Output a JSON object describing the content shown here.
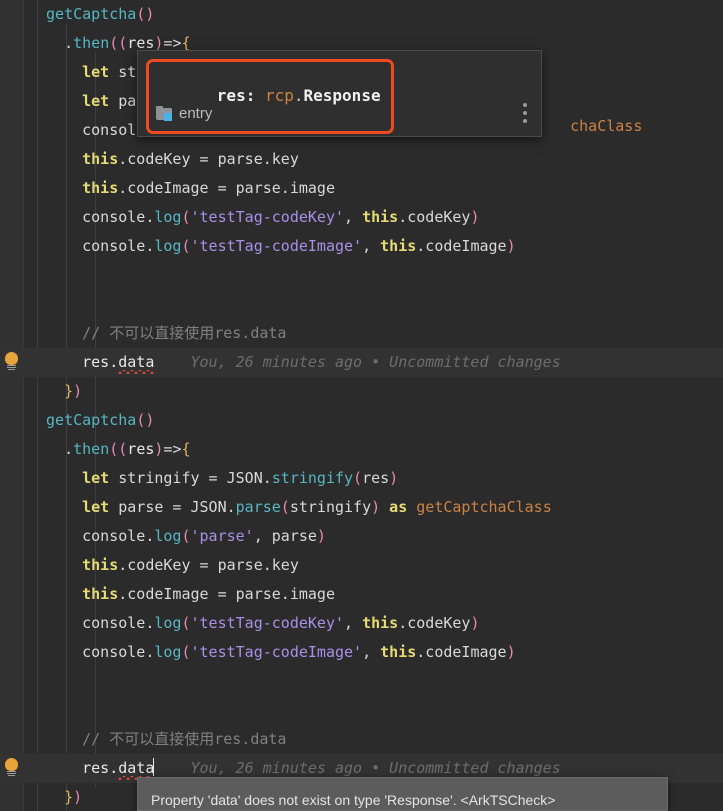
{
  "editor": {
    "theme_bg": "#2b2b2b",
    "gutter_bg": "#313131",
    "current_line_bg": "#323232"
  },
  "gutter": {
    "bulb_icon_name": "intention-bulb-icon",
    "bulb_color": "#e8a33d"
  },
  "code_lines": [
    {
      "indent": 1,
      "tokens": [
        {
          "t": "getCaptcha",
          "c": "t-fn"
        },
        {
          "t": "(",
          "c": "t-paren"
        },
        {
          "t": ")",
          "c": "t-paren"
        }
      ]
    },
    {
      "indent": 2,
      "tokens": [
        {
          "t": ".",
          "c": "t-plain"
        },
        {
          "t": "then",
          "c": "t-method"
        },
        {
          "t": "((",
          "c": "t-paren"
        },
        {
          "t": "res",
          "c": "t-white"
        },
        {
          "t": ")",
          "c": "t-paren"
        },
        {
          "t": "=>",
          "c": "t-plain"
        },
        {
          "t": "{",
          "c": "t-punct"
        }
      ]
    },
    {
      "indent": 3,
      "tokens": [
        {
          "t": "let",
          "c": "t-kw"
        },
        {
          "t": " st",
          "c": "t-plain"
        }
      ]
    },
    {
      "indent": 3,
      "tokens": [
        {
          "t": "let",
          "c": "t-kw"
        },
        {
          "t": " pa",
          "c": "t-plain"
        }
      ]
    },
    {
      "indent": 3,
      "tokens": [
        {
          "t": "consol",
          "c": "t-plain"
        }
      ]
    },
    {
      "indent": 3,
      "tokens": [
        {
          "t": "this",
          "c": "t-kw"
        },
        {
          "t": ".codeKey ",
          "c": "t-plain"
        },
        {
          "t": "=",
          "c": "t-op"
        },
        {
          "t": " parse.key",
          "c": "t-plain"
        }
      ]
    },
    {
      "indent": 3,
      "tokens": [
        {
          "t": "this",
          "c": "t-kw"
        },
        {
          "t": ".codeImage ",
          "c": "t-plain"
        },
        {
          "t": "=",
          "c": "t-op"
        },
        {
          "t": " parse.image",
          "c": "t-plain"
        }
      ]
    },
    {
      "indent": 3,
      "tokens": [
        {
          "t": "console",
          "c": "t-plain"
        },
        {
          "t": ".",
          "c": "t-plain"
        },
        {
          "t": "log",
          "c": "t-method"
        },
        {
          "t": "(",
          "c": "t-paren"
        },
        {
          "t": "'testTag-codeKey'",
          "c": "t-str"
        },
        {
          "t": ", ",
          "c": "t-plain"
        },
        {
          "t": "this",
          "c": "t-kw"
        },
        {
          "t": ".codeKey",
          "c": "t-plain"
        },
        {
          "t": ")",
          "c": "t-paren"
        }
      ]
    },
    {
      "indent": 3,
      "tokens": [
        {
          "t": "console",
          "c": "t-plain"
        },
        {
          "t": ".",
          "c": "t-plain"
        },
        {
          "t": "log",
          "c": "t-method"
        },
        {
          "t": "(",
          "c": "t-paren"
        },
        {
          "t": "'testTag-codeImage'",
          "c": "t-str"
        },
        {
          "t": ", ",
          "c": "t-plain"
        },
        {
          "t": "this",
          "c": "t-kw"
        },
        {
          "t": ".codeImage",
          "c": "t-plain"
        },
        {
          "t": ")",
          "c": "t-paren"
        }
      ]
    },
    {
      "indent": 0,
      "tokens": []
    },
    {
      "indent": 0,
      "tokens": []
    },
    {
      "indent": 3,
      "tokens": [
        {
          "t": "// 不可以直接使用res.data",
          "c": "t-comment"
        }
      ]
    },
    {
      "indent": 3,
      "tokens": [
        {
          "t": "res.",
          "c": "t-white"
        },
        {
          "t": "data",
          "c": "t-white",
          "squiggle": true
        }
      ],
      "blame": "You, 26 minutes ago • Uncommitted changes",
      "current": true
    },
    {
      "indent": 2,
      "tokens": [
        {
          "t": "}",
          "c": "t-punct"
        },
        {
          "t": ")",
          "c": "t-paren"
        }
      ]
    },
    {
      "indent": 1,
      "tokens": [
        {
          "t": "getCaptcha",
          "c": "t-fn"
        },
        {
          "t": "(",
          "c": "t-paren"
        },
        {
          "t": ")",
          "c": "t-paren"
        }
      ]
    },
    {
      "indent": 2,
      "tokens": [
        {
          "t": ".",
          "c": "t-plain"
        },
        {
          "t": "then",
          "c": "t-method"
        },
        {
          "t": "((",
          "c": "t-paren"
        },
        {
          "t": "res",
          "c": "t-white"
        },
        {
          "t": ")",
          "c": "t-paren"
        },
        {
          "t": "=>",
          "c": "t-plain"
        },
        {
          "t": "{",
          "c": "t-punct"
        }
      ]
    },
    {
      "indent": 3,
      "tokens": [
        {
          "t": "let",
          "c": "t-kw"
        },
        {
          "t": " stringify ",
          "c": "t-plain"
        },
        {
          "t": "=",
          "c": "t-op"
        },
        {
          "t": " JSON",
          "c": "t-plain"
        },
        {
          "t": ".",
          "c": "t-plain"
        },
        {
          "t": "stringify",
          "c": "t-method"
        },
        {
          "t": "(",
          "c": "t-paren"
        },
        {
          "t": "res",
          "c": "t-plain"
        },
        {
          "t": ")",
          "c": "t-paren"
        }
      ]
    },
    {
      "indent": 3,
      "tokens": [
        {
          "t": "let",
          "c": "t-kw"
        },
        {
          "t": " parse ",
          "c": "t-plain"
        },
        {
          "t": "=",
          "c": "t-op"
        },
        {
          "t": " JSON",
          "c": "t-plain"
        },
        {
          "t": ".",
          "c": "t-plain"
        },
        {
          "t": "parse",
          "c": "t-method"
        },
        {
          "t": "(",
          "c": "t-paren"
        },
        {
          "t": "stringify",
          "c": "t-plain"
        },
        {
          "t": ")",
          "c": "t-paren"
        },
        {
          "t": " ",
          "c": "t-plain"
        },
        {
          "t": "as",
          "c": "t-kw"
        },
        {
          "t": " ",
          "c": "t-plain"
        },
        {
          "t": "getCaptchaClass",
          "c": "t-cls"
        }
      ]
    },
    {
      "indent": 3,
      "tokens": [
        {
          "t": "console",
          "c": "t-plain"
        },
        {
          "t": ".",
          "c": "t-plain"
        },
        {
          "t": "log",
          "c": "t-method"
        },
        {
          "t": "(",
          "c": "t-paren"
        },
        {
          "t": "'parse'",
          "c": "t-str"
        },
        {
          "t": ", parse",
          "c": "t-plain"
        },
        {
          "t": ")",
          "c": "t-paren"
        }
      ]
    },
    {
      "indent": 3,
      "tokens": [
        {
          "t": "this",
          "c": "t-kw"
        },
        {
          "t": ".codeKey ",
          "c": "t-plain"
        },
        {
          "t": "=",
          "c": "t-op"
        },
        {
          "t": " parse.key",
          "c": "t-plain"
        }
      ]
    },
    {
      "indent": 3,
      "tokens": [
        {
          "t": "this",
          "c": "t-kw"
        },
        {
          "t": ".codeImage ",
          "c": "t-plain"
        },
        {
          "t": "=",
          "c": "t-op"
        },
        {
          "t": " parse.image",
          "c": "t-plain"
        }
      ]
    },
    {
      "indent": 3,
      "tokens": [
        {
          "t": "console",
          "c": "t-plain"
        },
        {
          "t": ".",
          "c": "t-plain"
        },
        {
          "t": "log",
          "c": "t-method"
        },
        {
          "t": "(",
          "c": "t-paren"
        },
        {
          "t": "'testTag-codeKey'",
          "c": "t-str"
        },
        {
          "t": ", ",
          "c": "t-plain"
        },
        {
          "t": "this",
          "c": "t-kw"
        },
        {
          "t": ".codeKey",
          "c": "t-plain"
        },
        {
          "t": ")",
          "c": "t-paren"
        }
      ]
    },
    {
      "indent": 3,
      "tokens": [
        {
          "t": "console",
          "c": "t-plain"
        },
        {
          "t": ".",
          "c": "t-plain"
        },
        {
          "t": "log",
          "c": "t-method"
        },
        {
          "t": "(",
          "c": "t-paren"
        },
        {
          "t": "'testTag-codeImage'",
          "c": "t-str"
        },
        {
          "t": ", ",
          "c": "t-plain"
        },
        {
          "t": "this",
          "c": "t-kw"
        },
        {
          "t": ".codeImage",
          "c": "t-plain"
        },
        {
          "t": ")",
          "c": "t-paren"
        }
      ]
    },
    {
      "indent": 0,
      "tokens": []
    },
    {
      "indent": 0,
      "tokens": []
    },
    {
      "indent": 3,
      "tokens": [
        {
          "t": "// 不可以直接使用res.data",
          "c": "t-comment"
        }
      ]
    },
    {
      "indent": 3,
      "tokens": [
        {
          "t": "res.",
          "c": "t-white"
        },
        {
          "t": "data",
          "c": "t-white",
          "squiggle": true
        },
        {
          "caret": true
        }
      ],
      "blame": "You, 26 minutes ago • Uncommitted changes",
      "current": true
    },
    {
      "indent": 2,
      "tokens": [
        {
          "t": "}",
          "c": "t-punct"
        },
        {
          "t": ")",
          "c": "t-paren"
        }
      ]
    }
  ],
  "overflow_text": {
    "captcha_class_tail": "chaClass"
  },
  "param_popup": {
    "param_name": "res:",
    "type_namespace": "rcp",
    "type_dot": ".",
    "type_name": "Response",
    "module_label": "entry",
    "folder_icon_name": "module-folder-icon",
    "kebab_icon_name": "more-options-icon",
    "highlight_border_color": "#f04a22"
  },
  "error_tooltip": {
    "message": "Property 'data' does not exist on type 'Response'. <ArkTSCheck>",
    "bg": "#5c5c5c"
  }
}
